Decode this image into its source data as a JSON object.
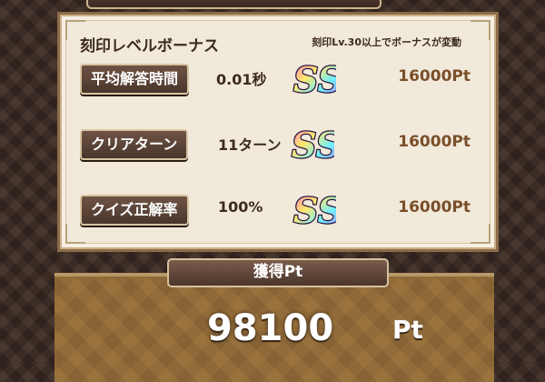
{
  "bonus_panel": {
    "title": "刻印レベルボーナス",
    "note": "刻印Lv.30以上でボーナスが変動",
    "rows": [
      {
        "label": "平均解答時間",
        "value": "0.01秒",
        "rank": "SS",
        "points": "16000Pt"
      },
      {
        "label": "クリアターン",
        "value": "11ターン",
        "rank": "SS",
        "points": "16000Pt"
      },
      {
        "label": "クイズ正解率",
        "value": "100%",
        "rank": "SS",
        "points": "16000Pt"
      }
    ]
  },
  "total": {
    "label": "獲得Pt",
    "value": "98100",
    "unit": "Pt"
  },
  "colors": {
    "label_bg": "#5a4034",
    "points_text": "#7a4f2a",
    "panel_bg": "#f1e9da"
  },
  "icons": {
    "rank_badge": "ss-rank-icon"
  }
}
